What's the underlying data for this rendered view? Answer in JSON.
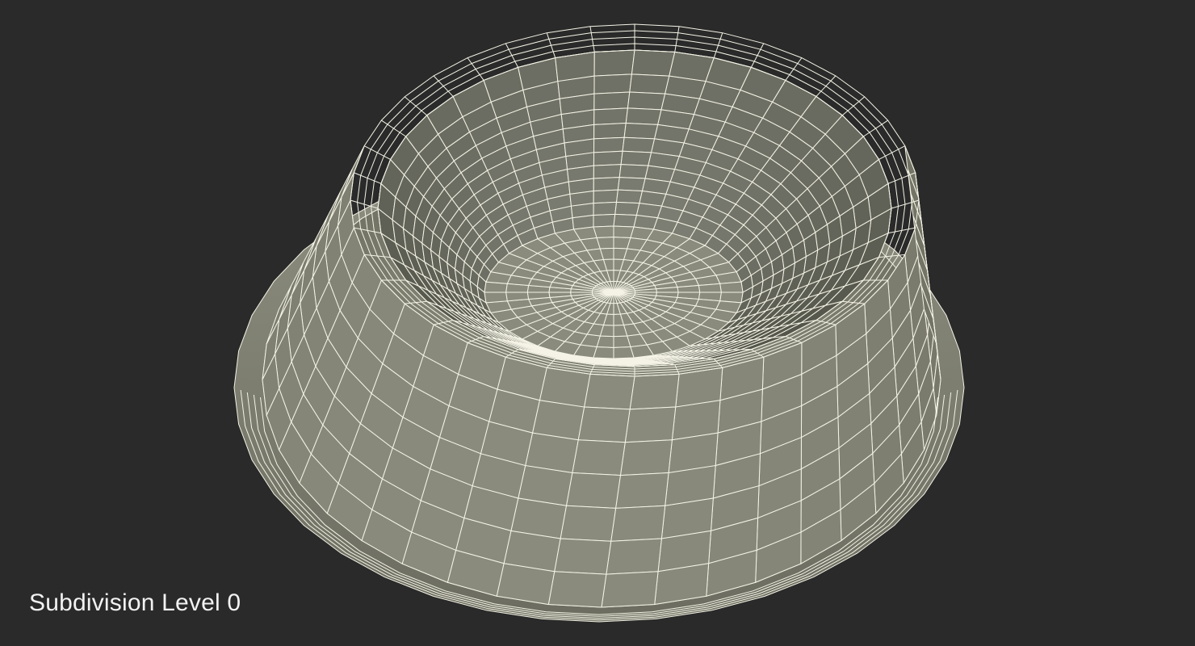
{
  "caption": "Subdivision Level 0",
  "colors": {
    "background": "#2a2a2a",
    "surface_light": "#8c8d7e",
    "surface_mid": "#7b7c6d",
    "surface_dark": "#56574b",
    "wire": "#f4f3e6"
  },
  "subject": {
    "icon": "wireframe-bowl-mesh"
  }
}
